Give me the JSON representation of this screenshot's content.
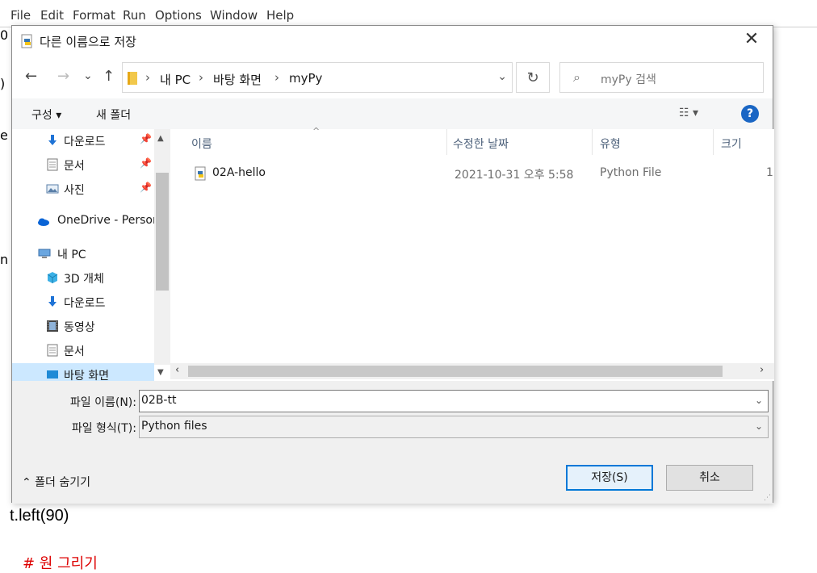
{
  "editor": {
    "menu": [
      "File",
      "Edit",
      "Format",
      "Run",
      "Options",
      "Window",
      "Help"
    ],
    "gutter_chars": [
      "0",
      ")",
      "e",
      "n"
    ],
    "code_line": "t.left(90)",
    "red_line": "# 원 그리기"
  },
  "dialog": {
    "title": "다른 이름으로 저장",
    "close": "✕",
    "nav": {
      "back": "←",
      "forward": "→",
      "recent": "⌄",
      "up": "↑"
    },
    "breadcrumb": [
      "내 PC",
      "바탕 화면",
      "myPy"
    ],
    "breadcrumb_sep": "›",
    "refresh": "↻",
    "search_placeholder": "myPy 검색",
    "toolbar": {
      "organize": "구성 ▾",
      "new_folder": "새 폴더",
      "view": "☷ ▾",
      "help": "?"
    },
    "sidebar": [
      {
        "label": "다운로드",
        "icon": "download-icon",
        "pinned": true
      },
      {
        "label": "문서",
        "icon": "document-icon",
        "pinned": true
      },
      {
        "label": "사진",
        "icon": "pictures-icon",
        "pinned": true
      },
      {
        "label": "OneDrive - Personal",
        "icon": "onedrive-icon",
        "pinned": false
      },
      {
        "label": "내 PC",
        "icon": "computer-icon",
        "pinned": false
      },
      {
        "label": "3D 개체",
        "icon": "3d-objects-icon",
        "pinned": false
      },
      {
        "label": "다운로드",
        "icon": "download-icon",
        "pinned": false
      },
      {
        "label": "동영상",
        "icon": "video-icon",
        "pinned": false
      },
      {
        "label": "문서",
        "icon": "document-icon",
        "pinned": false
      },
      {
        "label": "바탕 화면",
        "icon": "desktop-icon",
        "pinned": false
      }
    ],
    "columns": {
      "name": "이름",
      "modified": "수정한 날짜",
      "type": "유형",
      "size": "크기"
    },
    "files": [
      {
        "name": "02A-hello",
        "modified": "2021-10-31 오후 5:58",
        "type": "Python File",
        "size": "1"
      }
    ],
    "filename_label": "파일 이름(N):",
    "filename_value": "02B-tt",
    "filetype_label": "파일 형식(T):",
    "filetype_value": "Python files",
    "hide_folders": "⌃ 폴더 숨기기",
    "save_button": "저장(S)",
    "cancel_button": "취소"
  },
  "colors": {
    "accent": "#0078d7",
    "help": "#1a66c4",
    "folder": "#f2c84b",
    "selected": "#cce8ff"
  }
}
